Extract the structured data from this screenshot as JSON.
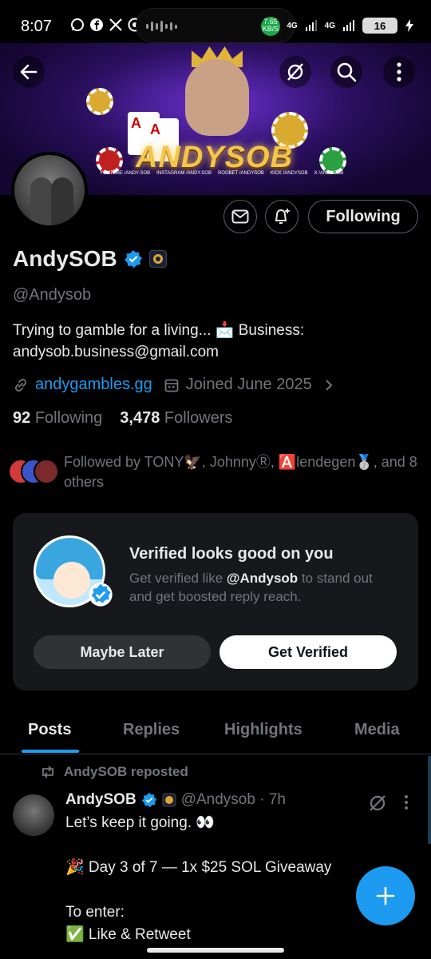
{
  "status_bar": {
    "time": "8:07",
    "app_icons": [
      "whatsapp-icon",
      "facebook-icon",
      "x-icon",
      "chrome-icon"
    ],
    "speed_value": "7.65",
    "speed_unit": "KB/S",
    "net1": "4G",
    "net2": "4G",
    "battery": "16"
  },
  "banner": {
    "brand_text": "ANDYSOB",
    "card_left": "A",
    "card_right": "A",
    "socials": [
      {
        "platform": "YOUTUBE",
        "handle": "/ANDY-SOB"
      },
      {
        "platform": "INSTAGRAM",
        "handle": "/ANDY.SOB"
      },
      {
        "platform": "ROOBET",
        "handle": "/ANDYSOB"
      },
      {
        "platform": "KICK",
        "handle": "/ANDYSOB"
      },
      {
        "platform": "X",
        "handle": "/ANDYSOB"
      }
    ]
  },
  "profile": {
    "name": "AndySOB",
    "handle": "@Andysob",
    "bio": "Trying to gamble for a living... 📩 Business: andysob.business@gmail.com",
    "website": "andygambles.gg",
    "joined": "Joined June 2025",
    "following_count": "92",
    "following_label": "Following",
    "followers_count": "3,478",
    "followers_label": "Followers",
    "followed_by": "Followed by TONY🦅, JohnnyⓇ, 🅰️lendegen🥈, and 8 others",
    "follow_button": "Following"
  },
  "verified_card": {
    "title": "Verified looks good on you",
    "desc_prefix": "Get verified like ",
    "desc_handle": "@Andysob",
    "desc_suffix": " to stand out and get boosted reply reach.",
    "later_label": "Maybe Later",
    "get_label": "Get Verified"
  },
  "tabs": [
    {
      "label": "Posts",
      "active": true
    },
    {
      "label": "Replies",
      "active": false
    },
    {
      "label": "Highlights",
      "active": false
    },
    {
      "label": "Media",
      "active": false
    }
  ],
  "post": {
    "repost_label": "AndySOB reposted",
    "author": "AndySOB",
    "handle_time": "@Andysob · 7h",
    "body": "Let’s keep it going. 👀\n\n🎉 Day 3 of 7 — 1x $25 SOL Giveaway\n\nTo enter:\n✅ Like & Retweet"
  },
  "colors": {
    "accent": "#1d9bf0",
    "muted": "#71767b",
    "text": "#e7e9ea",
    "card_bg": "#16181c"
  }
}
